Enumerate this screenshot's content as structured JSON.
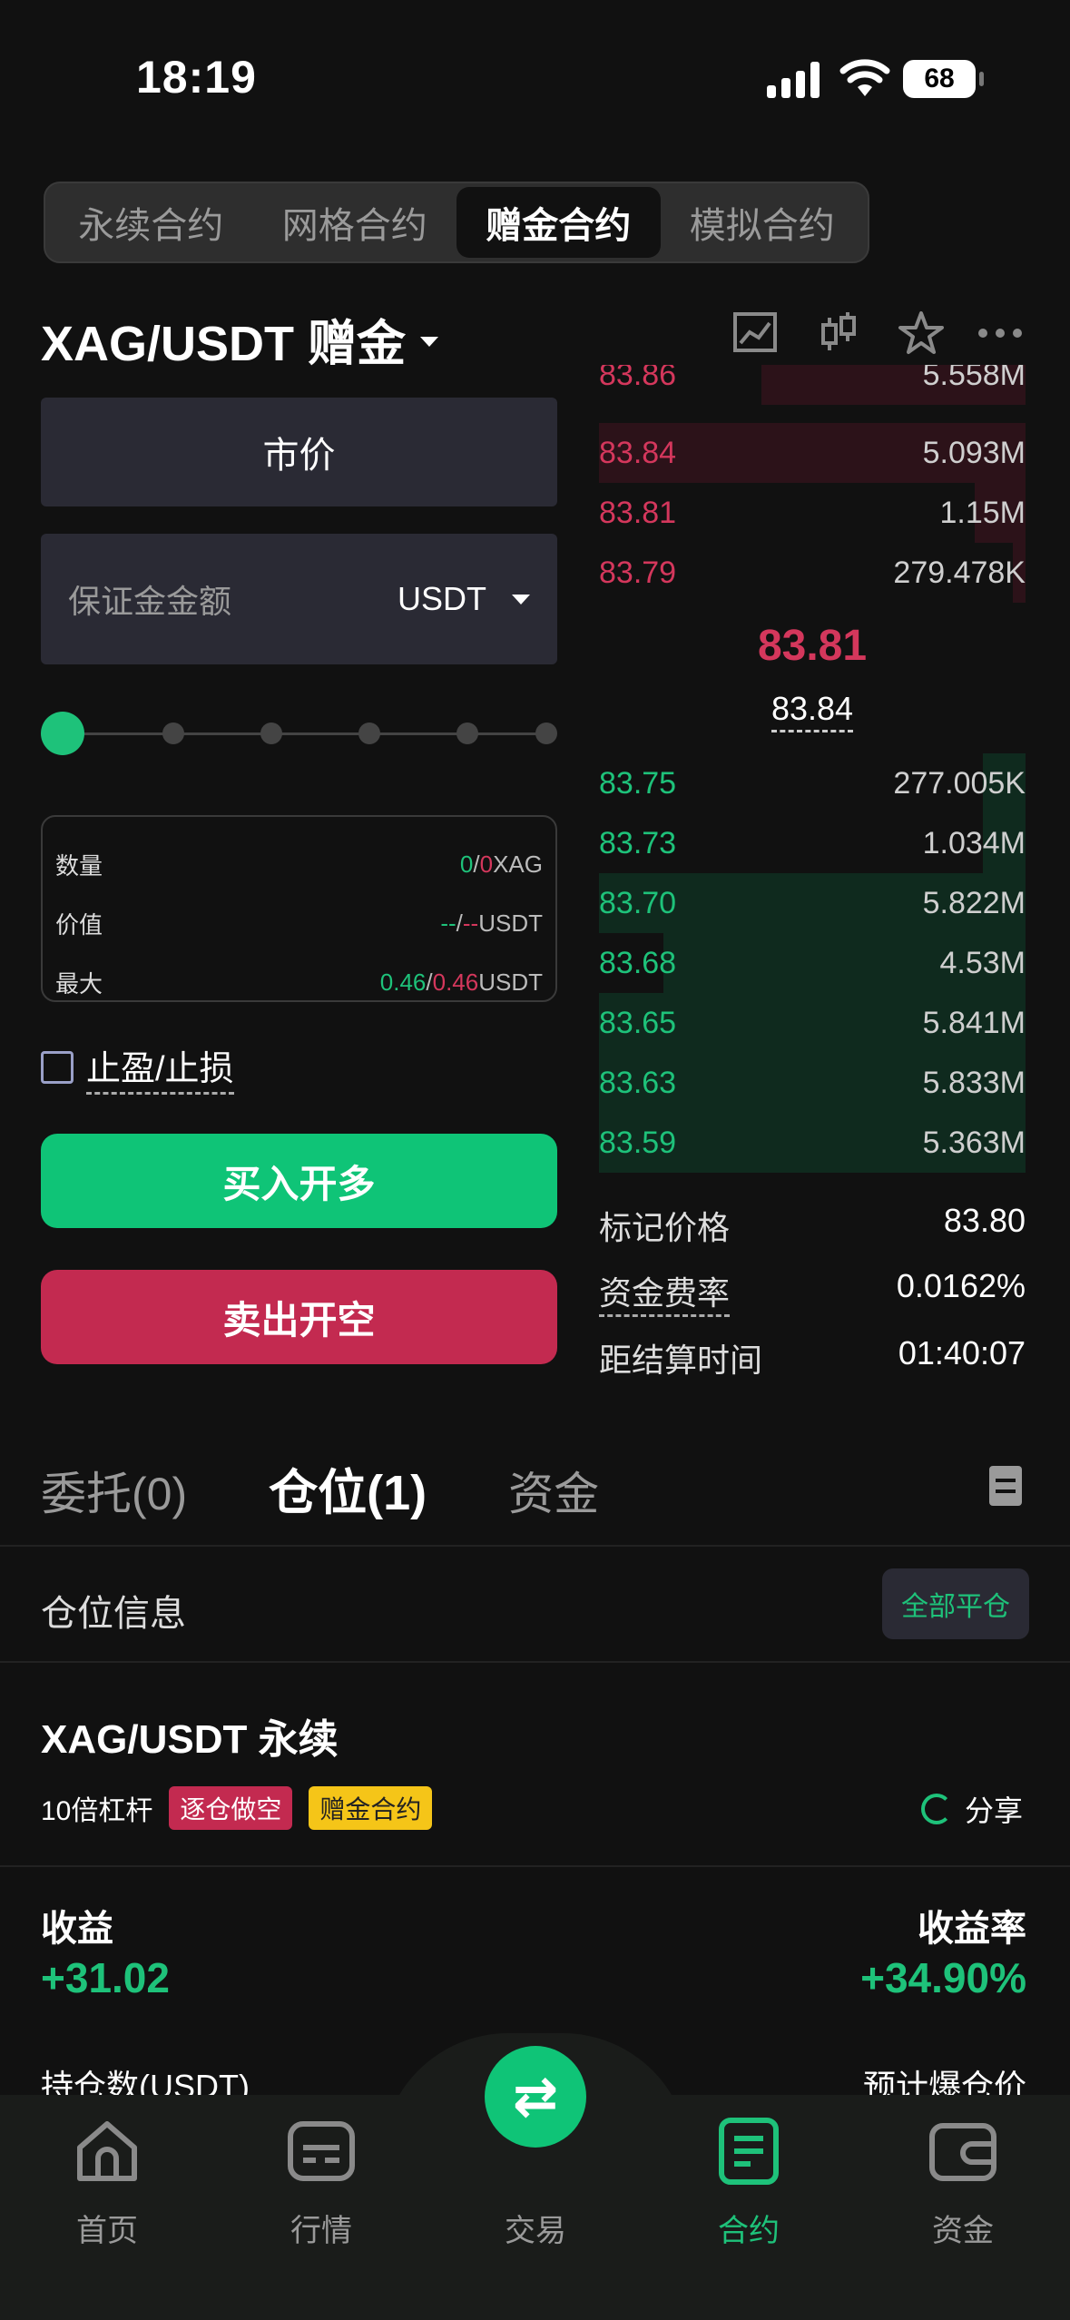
{
  "status_bar": {
    "time": "18:19",
    "battery": "68"
  },
  "segment_tabs": [
    {
      "label": "永续合约",
      "active": false
    },
    {
      "label": "网格合约",
      "active": false
    },
    {
      "label": "赠金合约",
      "active": true
    },
    {
      "label": "模拟合约",
      "active": false
    }
  ],
  "header": {
    "pair": "XAG/USDT 赠金",
    "icons": [
      "chart-line-icon",
      "candlestick-icon",
      "star-icon",
      "more-icon"
    ]
  },
  "form": {
    "order_type": "市价",
    "margin_placeholder": "保证金金额",
    "margin_unit": "USDT",
    "slider_steps": 6,
    "slider_value": 0,
    "info": {
      "qty_label": "数量",
      "qty_a": "0",
      "qty_b": "0",
      "qty_unit": "XAG",
      "value_label": "价值",
      "value_a": "--",
      "value_b": "--",
      "value_unit": "USDT",
      "max_label": "最大",
      "max_a": "0.46",
      "max_b": "0.46",
      "max_unit": "USDT"
    },
    "tpsl_label": "止盈/止损",
    "buy_label": "买入开多",
    "sell_label": "卖出开空"
  },
  "order_book": {
    "asks": [
      {
        "price": "83.86",
        "qty": "5.558M",
        "depth": 0.62
      },
      {
        "price": "83.84",
        "qty": "5.093M",
        "depth": 0.12
      },
      {
        "price": "83.81",
        "qty": "1.15M",
        "depth": 0.12
      },
      {
        "price": "83.79",
        "qty": "279.478K",
        "depth": 0.03
      }
    ],
    "last_price": "83.81",
    "mark_price_mid": "83.84",
    "bids": [
      {
        "price": "83.75",
        "qty": "277.005K",
        "depth": 0.1
      },
      {
        "price": "83.73",
        "qty": "1.034M",
        "depth": 0.1
      },
      {
        "price": "83.70",
        "qty": "5.822M",
        "depth": 0.84
      },
      {
        "price": "83.68",
        "qty": "4.53M",
        "depth": 0.66
      },
      {
        "price": "83.65",
        "qty": "5.841M",
        "depth": 1.0
      },
      {
        "price": "83.63",
        "qty": "5.833M",
        "depth": 1.0
      },
      {
        "price": "83.59",
        "qty": "5.363M",
        "depth": 1.0
      }
    ]
  },
  "stats": {
    "mark_price_label": "标记价格",
    "mark_price": "83.80",
    "funding_label": "资金费率",
    "funding": "0.0162%",
    "settle_label": "距结算时间",
    "settle": "01:40:07"
  },
  "orders_tabs": [
    {
      "label": "委托(0)",
      "active": false
    },
    {
      "label": "仓位(1)",
      "active": true
    },
    {
      "label": "资金",
      "active": false
    }
  ],
  "positions": {
    "title": "仓位信息",
    "close_all": "全部平仓",
    "symbol": "XAG/USDT 永续",
    "leverage": "10倍杠杆",
    "tag_side": "逐仓做空",
    "tag_type": "赠金合约",
    "share": "分享",
    "pnl_label": "收益",
    "pnl_value": "+31.02",
    "roe_label": "收益率",
    "roe_value": "+34.90%",
    "hold_label": "持仓数(USDT)",
    "liq_label": "预计爆仓价"
  },
  "bottom_nav": [
    {
      "label": "首页",
      "icon": "home-icon",
      "active": false
    },
    {
      "label": "行情",
      "icon": "market-icon",
      "active": false
    },
    {
      "label": "交易",
      "icon": "swap-icon",
      "active": false
    },
    {
      "label": "合约",
      "icon": "contract-icon",
      "active": true
    },
    {
      "label": "资金",
      "icon": "wallet-icon",
      "active": false
    }
  ],
  "colors": {
    "up": "#1ec27a",
    "down": "#d4375c",
    "bg": "#111111"
  }
}
